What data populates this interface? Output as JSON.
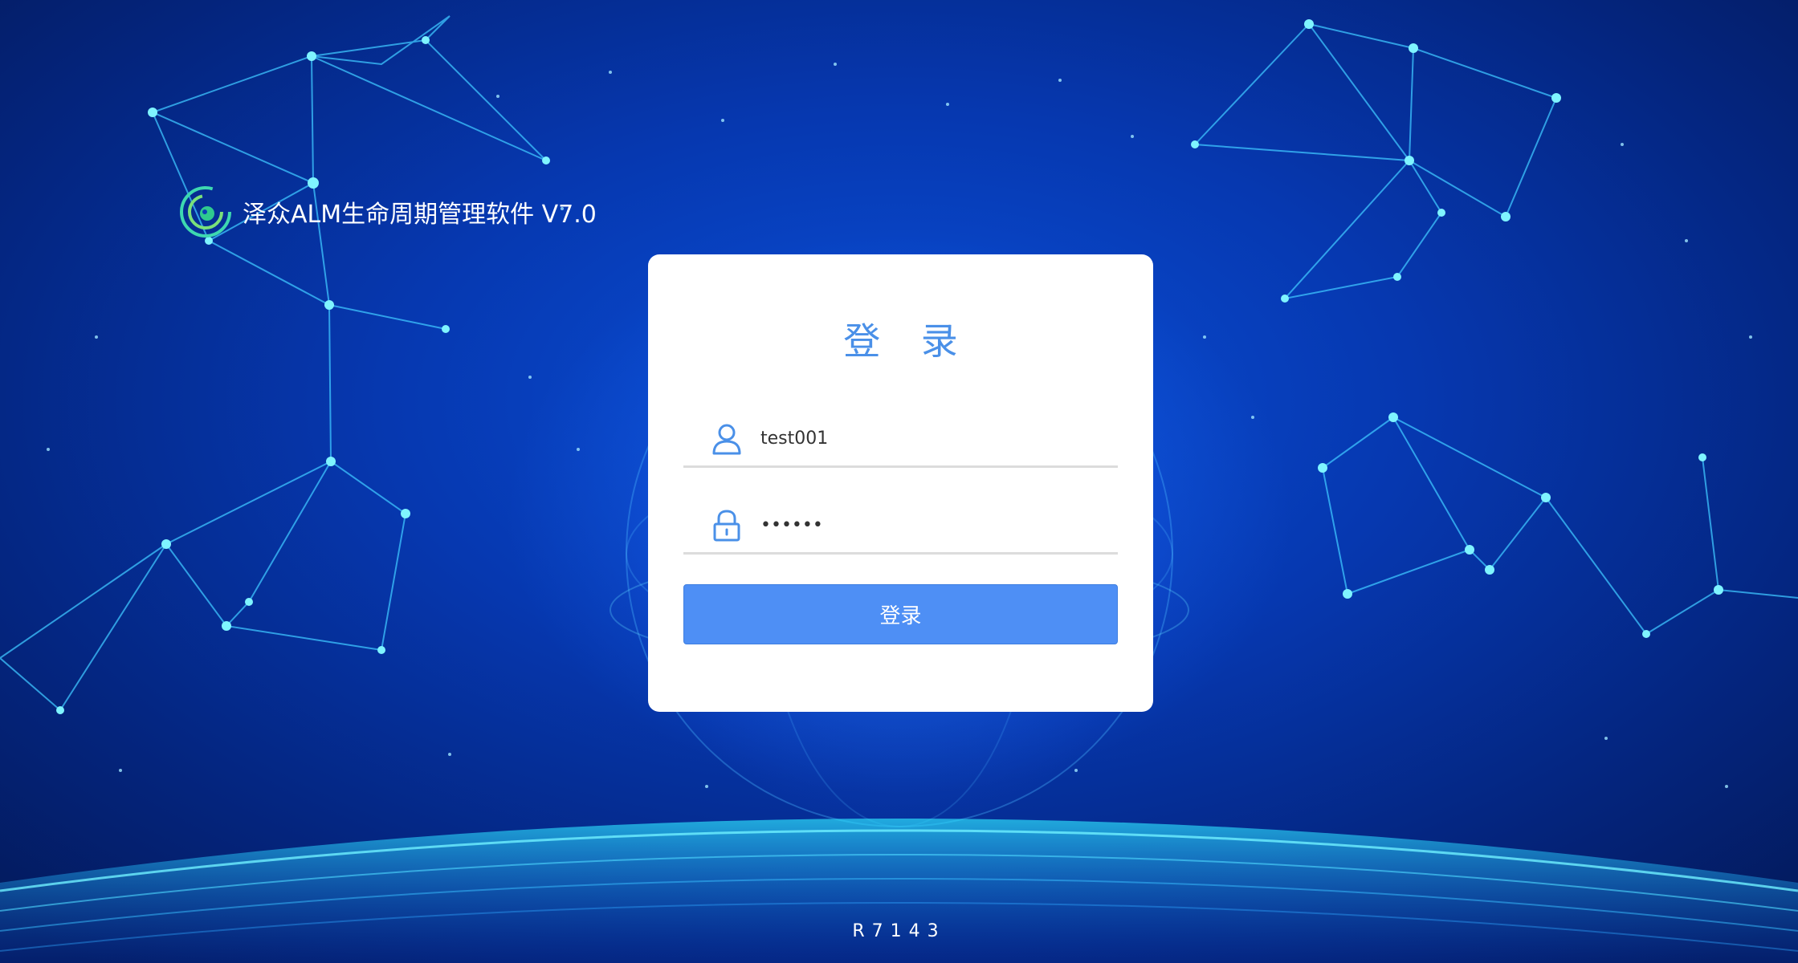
{
  "app": {
    "title": "泽众ALM生命周期管理软件 V7.0",
    "logo_icon": "leaf-circle-logo"
  },
  "login": {
    "heading": "登 录",
    "username_value": "test001",
    "password_value": "••••••",
    "submit_label": "登录"
  },
  "footer": {
    "version": "R7143"
  },
  "colors": {
    "accent": "#4e8ff5",
    "heading": "#4a90e8",
    "background": "#0638b0"
  }
}
